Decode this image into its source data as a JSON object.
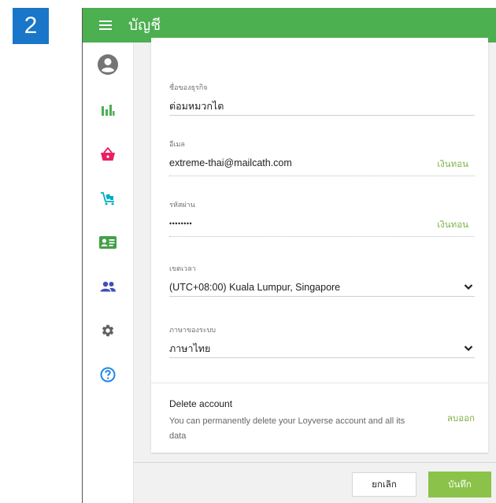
{
  "step_badge": "2",
  "topbar": {
    "title": "บัญชี",
    "menu_icon": "hamburger-menu-icon"
  },
  "sidebar": {
    "items": [
      {
        "name": "account",
        "icon": "user-circle-icon",
        "color": "#757575"
      },
      {
        "name": "reports",
        "icon": "bar-chart-icon",
        "color": "#4caf50"
      },
      {
        "name": "items",
        "icon": "basket-icon",
        "color": "#e91e63"
      },
      {
        "name": "inventory",
        "icon": "cart-boxes-icon",
        "color": "#00acc1"
      },
      {
        "name": "customers",
        "icon": "id-card-icon",
        "color": "#43a047"
      },
      {
        "name": "employees",
        "icon": "people-icon",
        "color": "#3f51b5"
      },
      {
        "name": "settings",
        "icon": "gear-icon",
        "color": "#616161"
      },
      {
        "name": "help",
        "icon": "help-circle-icon",
        "color": "#1e88e5"
      }
    ]
  },
  "form": {
    "business_name": {
      "label": "ชื่อของธุรกิจ",
      "value": "ต่อมหมวกไต"
    },
    "email": {
      "label": "อีเมล",
      "value": "extreme-thai@mailcath.com",
      "action": "เงินทอน"
    },
    "password": {
      "label": "รหัสผ่าน",
      "value": "••••••••",
      "action": "เงินทอน"
    },
    "timezone": {
      "label": "เขตเวลา",
      "value": "(UTC+08:00) Kuala Lumpur, Singapore"
    },
    "language": {
      "label": "ภาษาของระบบ",
      "value": "ภาษาไทย"
    }
  },
  "delete_account": {
    "title": "Delete account",
    "description": "You can permanently delete your Loyverse account and all its data",
    "action": "ลบออก"
  },
  "footer": {
    "cancel_label": "ยกเลิก",
    "save_label": "บันทึก"
  },
  "colors": {
    "brand_green": "#4caf50",
    "accent_green": "#8bc34a",
    "link_green": "#7fb24a",
    "badge_blue": "#1976c8"
  }
}
